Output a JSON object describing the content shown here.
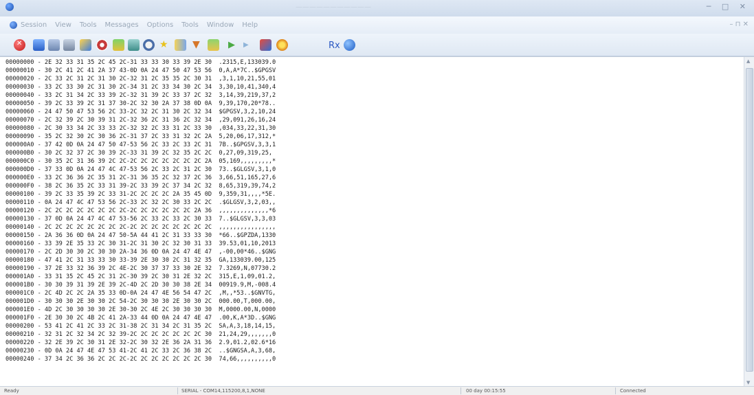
{
  "window": {
    "title": "———————————",
    "controls": "─ □ ✕"
  },
  "menu": {
    "items": [
      "Session",
      "View",
      "Tools",
      "Messages",
      "Options",
      "Tools",
      "Window",
      "Help"
    ],
    "right": "– ⊓ ✕"
  },
  "toolbar": {
    "icons": [
      "stop-icon",
      "new-session-icon",
      "open-icon",
      "view-icon",
      "wand-icon",
      "gear-icon",
      "chart-icon",
      "graph-icon",
      "gauge-icon",
      "star-icon",
      "star-bars-icon",
      "filter-icon",
      "flag-icon",
      "play-icon",
      "step-icon",
      "send-icon",
      "settings-icon"
    ],
    "rx_label": "Rx"
  },
  "hex": {
    "lines": [
      "00000000 - 2E 32 33 31 35 2C 45 2C-31 33 33 30 33 39 2E 30  .2315,E,133039.0",
      "00000010 - 30 2C 41 2C 41 2A 37 43-0D 0A 24 47 50 47 53 56  0,A,A*7C..$GPGSV",
      "00000020 - 2C 33 2C 31 2C 31 30 2C-32 31 2C 35 35 2C 30 31  ,3,1,10,21,55,01",
      "00000030 - 33 2C 33 30 2C 31 30 2C-34 31 2C 33 34 30 2C 34  3,30,10,41,340,4",
      "00000040 - 33 2C 31 34 2C 33 39 2C-32 31 39 2C 33 37 2C 32  3,14,39,219,37,2",
      "00000050 - 39 2C 33 39 2C 31 37 30-2C 32 30 2A 37 38 0D 0A  9,39,170,20*78..",
      "00000060 - 24 47 50 47 53 56 2C 33-2C 32 2C 31 30 2C 32 34  $GPGSV,3,2,10,24",
      "00000070 - 2C 32 39 2C 30 39 31 2C-32 36 2C 31 36 2C 32 34  ,29,091,26,16,24",
      "00000080 - 2C 30 33 34 2C 33 33 2C-32 32 2C 33 31 2C 33 30  ,034,33,22,31,30",
      "00000090 - 35 2C 32 30 2C 30 36 2C-31 37 2C 33 31 32 2C 2A  5,20,06,17,312,*",
      "000000A0 - 37 42 0D 0A 24 47 50 47-53 56 2C 33 2C 33 2C 31  7B..$GPGSV,3,3,1",
      "000000B0 - 30 2C 32 37 2C 30 39 2C-33 31 39 2C 32 35 2C 2C  0,27,09,319,25,",
      "000000C0 - 30 35 2C 31 36 39 2C 2C-2C 2C 2C 2C 2C 2C 2C 2A  05,169,,,,,,,,,*",
      "000000D0 - 37 33 0D 0A 24 47 4C 47-53 56 2C 33 2C 31 2C 30  73..$GLGSV,3,1,0",
      "000000E0 - 33 2C 36 36 2C 35 31 2C-31 36 35 2C 32 37 2C 36  3,66,51,165,27,6",
      "000000F0 - 38 2C 36 35 2C 33 31 39-2C 33 39 2C 37 34 2C 32  8,65,319,39,74,2",
      "00000100 - 39 2C 33 35 39 2C 33 31-2C 2C 2C 2C 2A 35 45 0D  9,359,31,,,,*5E.",
      "00000110 - 0A 24 47 4C 47 53 56 2C-33 2C 32 2C 30 33 2C 2C  .$GLGSV,3,2,03,,",
      "00000120 - 2C 2C 2C 2C 2C 2C 2C 2C-2C 2C 2C 2C 2C 2C 2A 36  ,,,,,,,,,,,,,,*6",
      "00000130 - 37 0D 0A 24 47 4C 47 53-56 2C 33 2C 33 2C 30 33  7..$GLGSV,3,3,03",
      "00000140 - 2C 2C 2C 2C 2C 2C 2C 2C-2C 2C 2C 2C 2C 2C 2C 2C  ,,,,,,,,,,,,,,,,",
      "00000150 - 2A 36 36 0D 0A 24 47 50-5A 44 41 2C 31 33 33 30  *66..$GPZDA,1330",
      "00000160 - 33 39 2E 35 33 2C 30 31-2C 31 30 2C 32 30 31 33  39.53,01,10,2013",
      "00000170 - 2C 2D 30 30 2C 30 30 2A-34 36 0D 0A 24 47 4E 47  ,-00,00*46..$GNG",
      "00000180 - 47 41 2C 31 33 33 30 33-39 2E 30 30 2C 31 32 35  GA,133039.00,125",
      "00000190 - 37 2E 33 32 36 39 2C 4E-2C 30 37 37 33 30 2E 32  7.3269,N,07730.2",
      "000001A0 - 33 31 35 2C 45 2C 31 2C-30 39 2C 30 31 2E 32 2C  315,E,1,09,01.2,",
      "000001B0 - 30 30 39 31 39 2E 39 2C-4D 2C 2D 30 30 38 2E 34  00919.9,M,-008.4",
      "000001C0 - 2C 4D 2C 2C 2A 35 33 0D-0A 24 47 4E 56 54 47 2C  ,M,,*53..$GNVTG,",
      "000001D0 - 30 30 30 2E 30 30 2C 54-2C 30 30 30 2E 30 30 2C  000.00,T,000.00,",
      "000001E0 - 4D 2C 30 30 30 30 2E 30-30 2C 4E 2C 30 30 30 30  M,0000.00,N,0000",
      "000001F0 - 2E 30 30 2C 4B 2C 41 2A-33 44 0D 0A 24 47 4E 47  .00,K,A*3D..$GNG",
      "00000200 - 53 41 2C 41 2C 33 2C 31-38 2C 31 34 2C 31 35 2C  SA,A,3,18,14,15,",
      "00000210 - 32 31 2C 32 34 2C 32 39-2C 2C 2C 2C 2C 2C 2C 30  21,24,29,,,,,,,0",
      "00000220 - 32 2E 39 2C 30 31 2E 32-2C 30 32 2E 36 2A 31 36  2.9,01.2,02.6*16",
      "00000230 - 0D 0A 24 47 4E 47 53 41-2C 41 2C 33 2C 36 38 2C  ..$GNGSA,A,3,68,",
      "00000240 - 37 34 2C 36 36 2C 2C 2C-2C 2C 2C 2C 2C 2C 2C 30  74,66,,,,,,,,,,0"
    ]
  },
  "status": {
    "ready": "Ready",
    "connection": "SERIAL - COM14,115200,8,1,NONE",
    "time": "00 day 00:15:55",
    "state": "Connected"
  }
}
